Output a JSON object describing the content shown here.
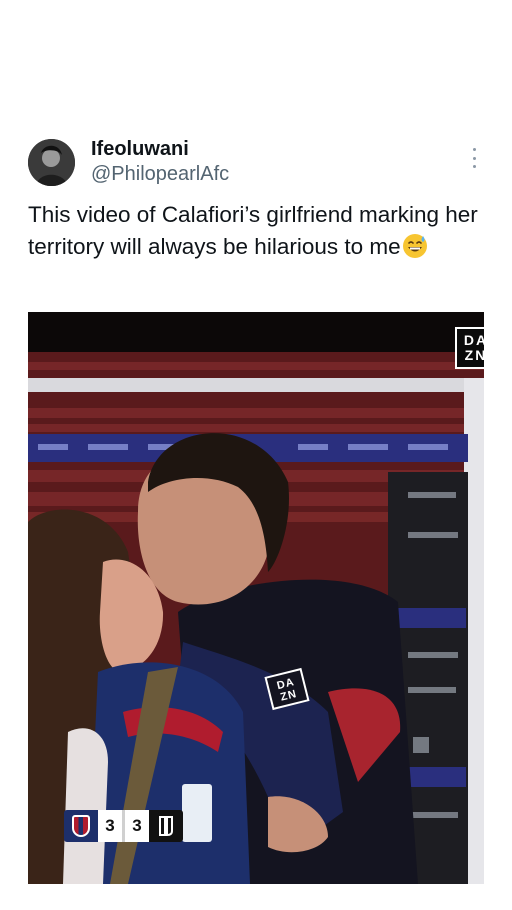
{
  "tweet": {
    "display_name": "Ifeoluwani",
    "handle": "@PhilopearlAfc",
    "text": "This video of Calafiori’s girlfriend marking her territory will always be hilarious to me",
    "emoji": "grinning-face-with-sweat-emoji",
    "more_icon": "more-vertical-icon"
  },
  "media": {
    "watermark": [
      "DA",
      "ZN"
    ],
    "chest_logo": [
      "DA",
      "ZN"
    ],
    "scoreboard": {
      "home_score": "3",
      "away_score": "3",
      "home_crest": "bologna-crest-icon",
      "away_crest": "juventus-logo-icon"
    },
    "colors": {
      "dazn_black": "#0b0b0b",
      "bologna_red": "#b01c2e",
      "bologna_blue": "#1d2f6b"
    }
  }
}
